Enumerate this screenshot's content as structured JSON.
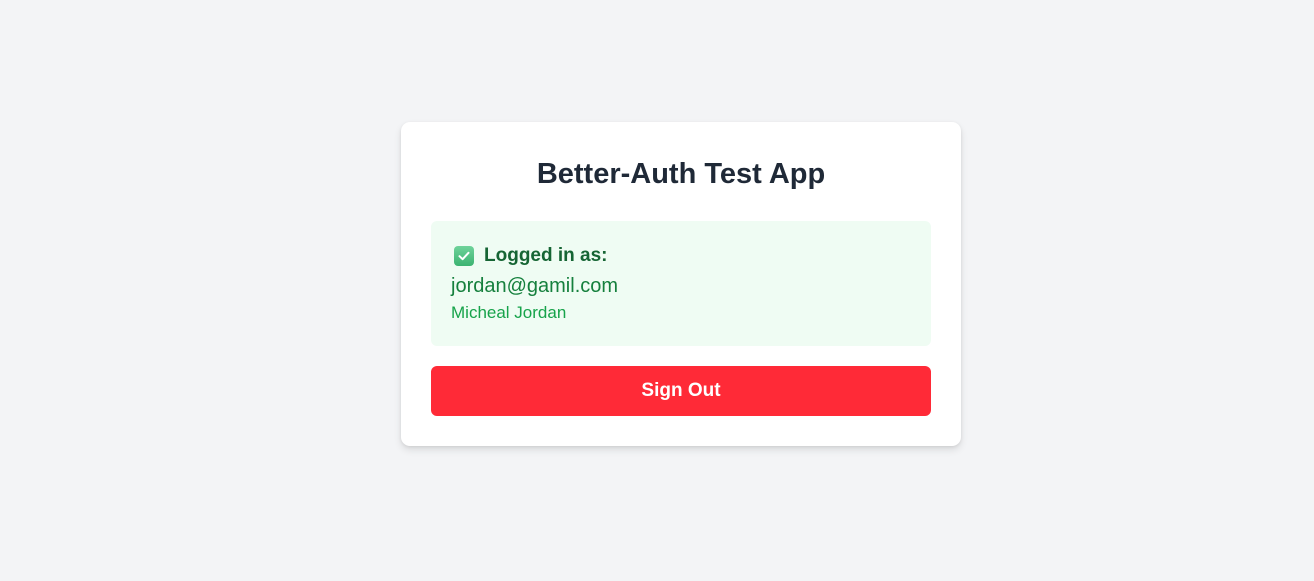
{
  "app": {
    "title": "Better-Auth Test App"
  },
  "session": {
    "status_icon": "check-box-icon",
    "status_label": "Logged in as:",
    "email": "jordan@gamil.com",
    "name": "Micheal Jordan"
  },
  "actions": {
    "sign_out_label": "Sign Out"
  },
  "colors": {
    "background": "#f3f4f6",
    "card": "#ffffff",
    "session_bg": "#effcf3",
    "danger": "#ff2a37",
    "title_text": "#1f2937",
    "success_text": "#166534"
  }
}
